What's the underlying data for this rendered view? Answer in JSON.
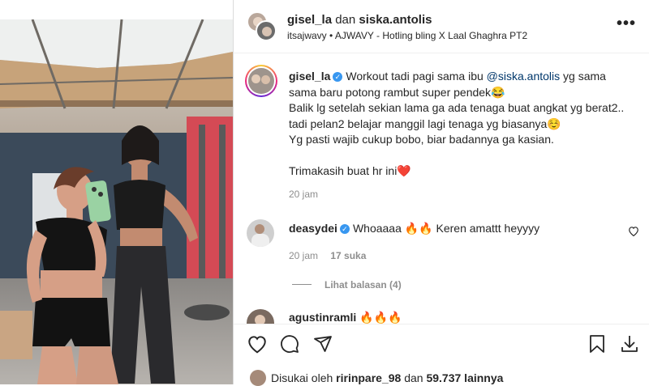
{
  "header": {
    "user1": "gisel_la",
    "joiner": "dan",
    "user2": "siska.antolis",
    "audio_artist": "itsajwavy",
    "audio_sep": "•",
    "audio_title": "AJWAVY - Hotling bling X Laal Ghaghra PT2",
    "more_label": "•••"
  },
  "caption": {
    "username": "gisel_la",
    "verified_mark": "✓",
    "text_before_mention": "Workout tadi pagi sama ibu ",
    "mention": "@siska.antolis",
    "text_after_mention": " yg sama sama baru potong rambut super pendek😂",
    "line2": "Balik lg setelah sekian lama ga ada tenaga buat angkat yg berat2.. tadi pelan2 belajar manggil lagi tenaga yg biasanya☺️",
    "line3": "Yg pasti wajib cukup bobo, biar badannya ga kasian.",
    "line4": "Trimakasih buat hr ini❤️",
    "time": "20 jam"
  },
  "comments": [
    {
      "username": "deasydei",
      "verified_mark": "✓",
      "text": "Whoaaaa 🔥🔥 Keren amattt heyyyy",
      "time": "20 jam",
      "likes": "17 suka",
      "view_replies": "Lihat balasan (4)"
    },
    {
      "username": "agustinramli",
      "text": "🔥🔥🔥"
    }
  ],
  "footer": {
    "liked_prefix": "Disukai oleh",
    "liked_user": "ririnpare_98",
    "liked_joiner": "dan",
    "liked_count": "59.737 lainnya"
  },
  "colors": {
    "verified": "#3897f0",
    "mention": "#00376b",
    "muted": "#8e8e8e",
    "heart_red": "#ed4956"
  }
}
